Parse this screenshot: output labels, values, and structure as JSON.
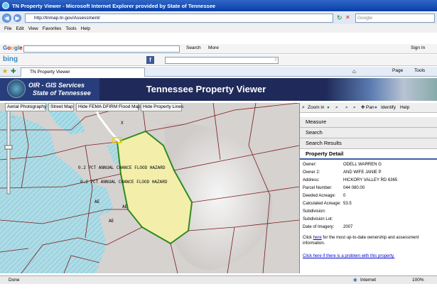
{
  "browser": {
    "title": "TN Property Viewer - Microsoft Internet Explorer provided by State of Tennessee",
    "address": "http://tnmap.tn.gov/Assessment/",
    "search_placeholder": "Google",
    "menu": [
      "File",
      "Edit",
      "View",
      "Favorites",
      "Tools",
      "Help"
    ],
    "google_toolbar": {
      "search_label": "Search",
      "more_label": "More",
      "signin_label": "Sign In"
    },
    "tab_title": "TN Property Viewer",
    "page_menu_label": "Page",
    "tools_menu_label": "Tools",
    "status": "Done",
    "zone": "Internet",
    "zoom": "100%"
  },
  "header": {
    "org_line1": "OIR - GIS Services",
    "org_line2": "State of Tennessee",
    "title": "Tennessee Property Viewer"
  },
  "map_buttons": [
    "Aerial Photography",
    "Street Map",
    "Hide FEMA DFIRM Flood Map",
    "Hide Property Lines"
  ],
  "map_labels": {
    "x_label": "X",
    "flood1": "0.2 PCT ANNUAL CHANCE FLOOD HAZARD",
    "flood2": "0.2 PCT ANNUAL CHANCE FLOOD HAZARD",
    "ae1": "AE",
    "ae2": "AE",
    "ae3": "AE"
  },
  "sidebar": {
    "tools": {
      "zoom_in": "Zoom in",
      "pan": "Pan",
      "identify": "Identify",
      "help": "Help"
    },
    "sections": [
      "Measure",
      "Search",
      "Search Results",
      "Property Detail"
    ],
    "details": [
      {
        "k": "Owner:",
        "v": "ODELL WARREN G"
      },
      {
        "k": "Owner 2:",
        "v": "AND WIFE JANIE P"
      },
      {
        "k": "Address:",
        "v": "HICKORY VALLEY RD 6365"
      },
      {
        "k": "Parcel Number:",
        "v": "044 080.00"
      },
      {
        "k": "Deeded Acreage:",
        "v": "0"
      },
      {
        "k": "Calculated Acreage:",
        "v": "53.5"
      },
      {
        "k": "Subdivision:",
        "v": ""
      },
      {
        "k": "Subdivision Lot:",
        "v": ""
      },
      {
        "k": "Date of Imagery:",
        "v": "2007"
      }
    ],
    "note_click": "Click",
    "note_here": "here",
    "note_rest": "for the most up-to-date ownership and assessment information.",
    "problem_link": "Click here if there is a problem with this property."
  },
  "colors": {
    "header_bg": "#1f2a5a",
    "flood_fill": "#a9dde8",
    "parcel_line": "#7a1a1a",
    "selected_parcel": "#2e8b1e"
  }
}
